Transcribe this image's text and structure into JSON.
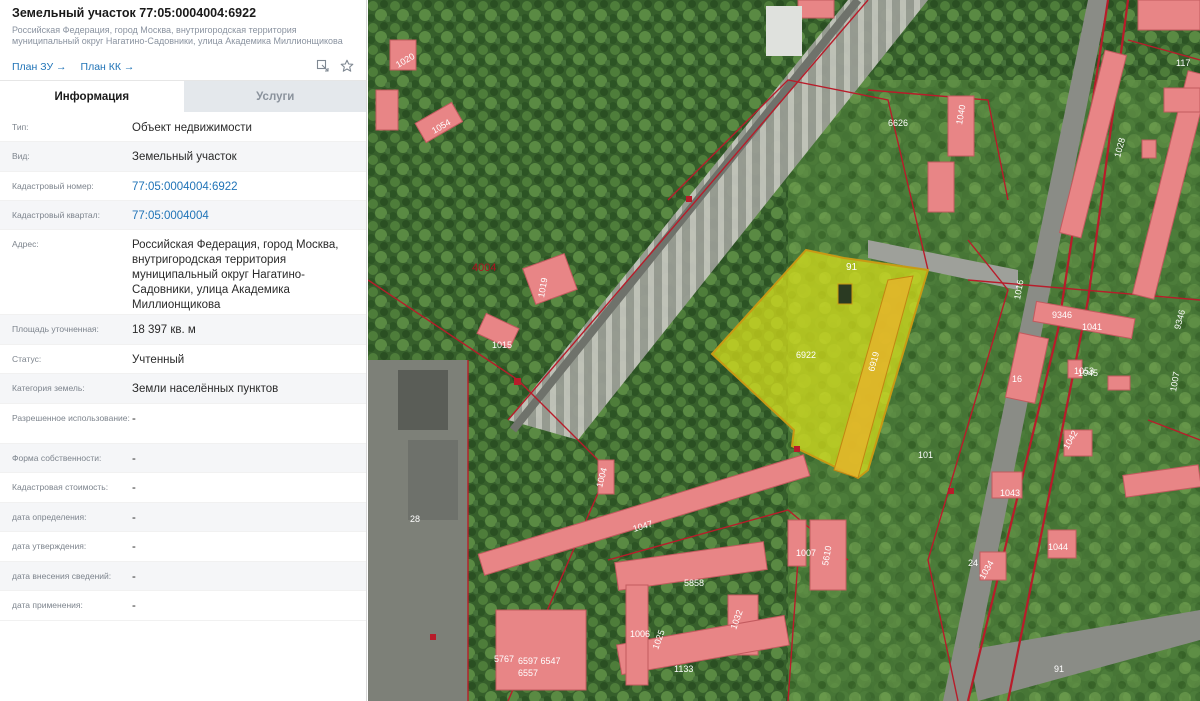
{
  "header": {
    "title": "Земельный участок 77:05:0004004:6922",
    "subtitle": "Российская Федерация, город Москва, внутригородская территория муниципальный округ Нагатино-Садовники, улица Академика Миллионщикова",
    "links": [
      "План ЗУ →",
      "План КК →"
    ]
  },
  "tabs": [
    "Информация",
    "Услуги"
  ],
  "rows": [
    {
      "label": "Тип:",
      "value": "Объект недвижимости"
    },
    {
      "label": "Вид:",
      "value": "Земельный участок"
    },
    {
      "label": "Кадастровый номер:",
      "value": "77:05:0004004:6922",
      "link": true
    },
    {
      "label": "Кадастровый квартал:",
      "value": "77:05:0004004",
      "link": true
    },
    {
      "label": "Адрес:",
      "value": "Российская Федерация, город Москва, внутригородская территория муниципальный округ Нагатино-Садовники, улица Академика Миллионщикова"
    },
    {
      "label": "Площадь уточненная:",
      "value": "18 397 кв. м"
    },
    {
      "label": "Статус:",
      "value": "Учтенный"
    },
    {
      "label": "Категория земель:",
      "value": "Земли населённых пунктов"
    },
    {
      "label": "Разрешенное использование:",
      "value": "-"
    },
    {
      "label": "Форма собственности:",
      "value": "-"
    },
    {
      "label": "Кадастровая стоимость:",
      "value": "-"
    },
    {
      "label": "дата определения:",
      "value": "-"
    },
    {
      "label": "дата утверждения:",
      "value": "-"
    },
    {
      "label": "дата внесения сведений:",
      "value": "-"
    },
    {
      "label": "дата применения:",
      "value": "-"
    }
  ],
  "map": {
    "labels": {
      "quarter": "4004",
      "parcel": "6922",
      "strip": "6919",
      "a91": "91",
      "a6626": "6626",
      "a1040": "1040",
      "a1054": "1054",
      "a1019": "1019",
      "a1020": "1020",
      "a1015": "1015",
      "a1047": "1047",
      "a1043": "1043",
      "a1007": "1007",
      "a1007b": "1007",
      "a9346": "9346",
      "a1041": "1041",
      "a16": "16",
      "a1042": "1042",
      "a1045": "1045",
      "a1044": "1044",
      "a24": "24",
      "a28": "28",
      "a101": "101",
      "a117": "117",
      "a1028": "1028",
      "a1006": "1006",
      "a5767": "5767",
      "a6597": "6597 6547",
      "a6557": "6557",
      "a1133": "1133",
      "a5858": "5858",
      "a1032": "1032",
      "a1025": "1025",
      "a9346b": "9346",
      "a5610": "5610",
      "a1004": "1004",
      "a1034": "1034",
      "a91b": "91",
      "a1016": "1016",
      "a1053": "1053"
    },
    "colors": {
      "forest": "#2f5a27",
      "forest_light": "#4f7a3c",
      "building": "#e88586",
      "boundary": "#b81c2a",
      "parcel_fill": "#d8df1a",
      "strip_fill": "#e4b52a",
      "road": "#8c8f86",
      "quarter_label": "#b01020"
    }
  }
}
